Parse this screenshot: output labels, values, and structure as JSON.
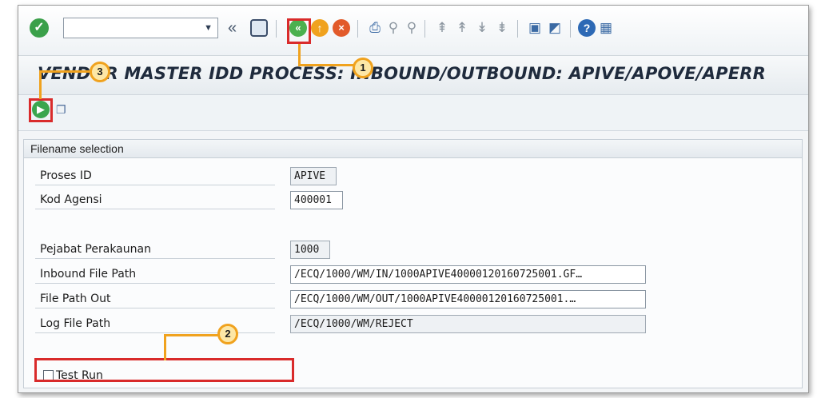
{
  "toolbar": {
    "command_field_value": "",
    "back_double_chevron": "«",
    "icons": [
      "checkmark-icon",
      "save-icon",
      "back-icon",
      "exit-icon",
      "cancel-icon",
      "print-icon",
      "find-icon",
      "find-next-icon",
      "first-page-icon",
      "previous-page-icon",
      "next-page-icon",
      "last-page-icon",
      "create-session-icon",
      "shortcut-icon",
      "help-icon",
      "customize-layout-icon"
    ]
  },
  "title": "VENDOR MASTER IDD PROCESS: INBOUND/OUTBOUND: APIVE/APOVE/APERR",
  "app_toolbar": {
    "icons": [
      "execute-icon",
      "get-variant-icon"
    ]
  },
  "group": {
    "header": "Filename selection",
    "fields": [
      {
        "label": "Proses ID",
        "value": "APIVE"
      },
      {
        "label": "Kod Agensi",
        "value": "400001"
      },
      {
        "label": "Pejabat Perakaunan",
        "value": "1000"
      },
      {
        "label": "Inbound File Path",
        "value": "/ECQ/1000/WM/IN/1000APIVE40000120160725001.GF…"
      },
      {
        "label": "File Path Out",
        "value": "/ECQ/1000/WM/OUT/1000APIVE40000120160725001.…"
      },
      {
        "label": "Log File Path",
        "value": "/ECQ/1000/WM/REJECT"
      }
    ],
    "checkbox": {
      "label": "Test Run",
      "checked": false
    }
  },
  "annotations": {
    "callout_1": "1",
    "callout_2": "2",
    "callout_3": "3",
    "color": "#f0a21e",
    "highlight_color": "#d92b2b"
  },
  "colors": {
    "ok_green": "#3aa04a",
    "title_text": "#1f2b3d"
  }
}
